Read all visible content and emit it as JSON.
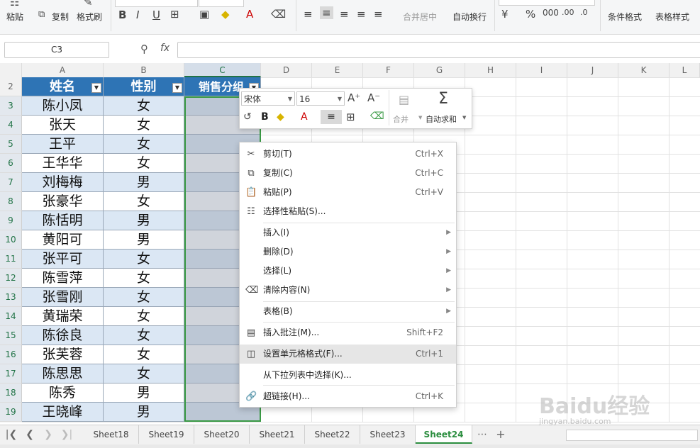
{
  "ribbon": {
    "paste": "粘贴",
    "copy": "复制",
    "format_painter": "格式刷",
    "merge_center": "合并居中",
    "wrap_text": "自动换行",
    "conditional_format": "条件格式",
    "table_style": "表格样式"
  },
  "formula_bar": {
    "name_box": "C3",
    "fx": "fx",
    "value": ""
  },
  "columns": [
    "A",
    "B",
    "C",
    "D",
    "E",
    "F",
    "G",
    "H",
    "I",
    "J",
    "K",
    "L"
  ],
  "rows": [
    "2",
    "3",
    "4",
    "5",
    "6",
    "7",
    "8",
    "9",
    "10",
    "11",
    "12",
    "13",
    "14",
    "15",
    "16",
    "17",
    "18",
    "19"
  ],
  "table": {
    "headers": [
      "姓名",
      "性别",
      "销售分组"
    ],
    "names": [
      "陈小凤",
      "张天",
      "王平",
      "王华华",
      "刘梅梅",
      "张豪华",
      "陈恬明",
      "黄阳可",
      "张平可",
      "陈雪萍",
      "张雪刚",
      "黄瑞荣",
      "陈徐良",
      "张芙蓉",
      "陈思思",
      "陈秀",
      "王晓峰"
    ],
    "genders": [
      "女",
      "女",
      "女",
      "女",
      "男",
      "女",
      "男",
      "男",
      "女",
      "女",
      "女",
      "女",
      "女",
      "女",
      "女",
      "男",
      "男"
    ]
  },
  "mini_toolbar": {
    "font": "宋体",
    "size": "16",
    "merge": "合并",
    "autosum": "自动求和"
  },
  "context_menu": [
    {
      "label": "剪切(T)",
      "shortcut": "Ctrl+X"
    },
    {
      "label": "复制(C)",
      "shortcut": "Ctrl+C"
    },
    {
      "label": "粘贴(P)",
      "shortcut": "Ctrl+V"
    },
    {
      "label": "选择性粘贴(S)...",
      "shortcut": ""
    },
    {
      "label": "插入(I)",
      "shortcut": ""
    },
    {
      "label": "删除(D)",
      "shortcut": ""
    },
    {
      "label": "选择(L)",
      "shortcut": ""
    },
    {
      "label": "清除内容(N)",
      "shortcut": ""
    },
    {
      "label": "表格(B)",
      "shortcut": ""
    },
    {
      "label": "插入批注(M)...",
      "shortcut": "Shift+F2"
    },
    {
      "label": "设置单元格格式(F)...",
      "shortcut": "Ctrl+1"
    },
    {
      "label": "从下拉列表中选择(K)...",
      "shortcut": ""
    },
    {
      "label": "超链接(H)...",
      "shortcut": "Ctrl+K"
    }
  ],
  "sheet_tabs": [
    "Sheet18",
    "Sheet19",
    "Sheet20",
    "Sheet21",
    "Sheet22",
    "Sheet23",
    "Sheet24"
  ],
  "active_tab": "Sheet24",
  "colors": {
    "header_fill": "#2e74b5",
    "band_fill": "#dbe7f4",
    "selection_border": "#3a9a45",
    "active_tab": "#2a8d3e"
  },
  "watermark": {
    "brand": "Baidu经验",
    "url": "jingyan.baidu.com"
  }
}
